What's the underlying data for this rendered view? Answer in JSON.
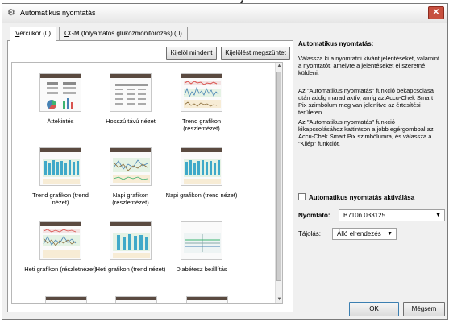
{
  "window": {
    "title": "Automatikus nyomtatás",
    "close_label": "✕"
  },
  "tabs": [
    {
      "label": "Vércukor (0)",
      "accel": "V",
      "rest": "ércukor (0)"
    },
    {
      "label": "CGM (folyamatos glükózmonitorozás) (0)",
      "accel": "C",
      "rest": "GM (folyamatos glükózmonitorozás) (0)"
    }
  ],
  "toolbar": {
    "select_all": "Kijelöl mindent",
    "clear_selection": "Kijelölést megszüntet"
  },
  "reports": [
    {
      "label": "Áttekintés",
      "icon": "overview-report-icon"
    },
    {
      "label": "Hosszú távú nézet",
      "icon": "long-term-report-icon"
    },
    {
      "label": "Trend grafikon (részletnézet)",
      "icon": "trend-detail-report-icon"
    },
    {
      "label": "Trend grafikon (trend nézet)",
      "icon": "trend-trend-report-icon"
    },
    {
      "label": "Napi grafikon (részletnézet)",
      "icon": "daily-detail-report-icon"
    },
    {
      "label": "Napi grafikon (trend nézet)",
      "icon": "daily-trend-report-icon"
    },
    {
      "label": "Heti grafikon (részletnézet)",
      "icon": "weekly-detail-report-icon"
    },
    {
      "label": "Heti grafikon (trend nézet)",
      "icon": "weekly-trend-report-icon"
    },
    {
      "label": "Diabétesz beállítás",
      "icon": "diabetes-settings-report-icon"
    }
  ],
  "info": {
    "heading": "Automatikus nyomtatás:",
    "para1": "Válassza ki a nyomtatni kívánt jelentéseket, valamint a nyomtatót, amelyre a jelentéseket el szeretné küldeni.",
    "para2": "Az \"Automatikus nyomtatás\" funkció bekapcsolása után addig marad aktív, amíg az Accu-Chek Smart Pix szimbólum meg van jelenítve az értesítési területen.",
    "para3": "Az \"Automatikus nyomtatás\" funkció kikapcsolásához kattintson a jobb egérgombbal az Accu-Chek Smart Pix szimbólumra, és válassza a \"Kilép\" funkciót."
  },
  "settings": {
    "auto_print_label": "Automatikus nyomtatás aktiválása",
    "auto_print_checked": false,
    "printer_label": "Nyomtató:",
    "printer_value": "B710n 033125",
    "orientation_label": "Tájolás:",
    "orientation_value": "Álló elrendezés"
  },
  "footer": {
    "ok_label": "OK",
    "cancel_label": "Mégsem"
  },
  "colors": {
    "header_brown": "#5a4a40",
    "close_red": "#c7503f",
    "chart_green": "#3cb371",
    "chart_blue": "#4682b4",
    "chart_red": "#d9534f"
  }
}
